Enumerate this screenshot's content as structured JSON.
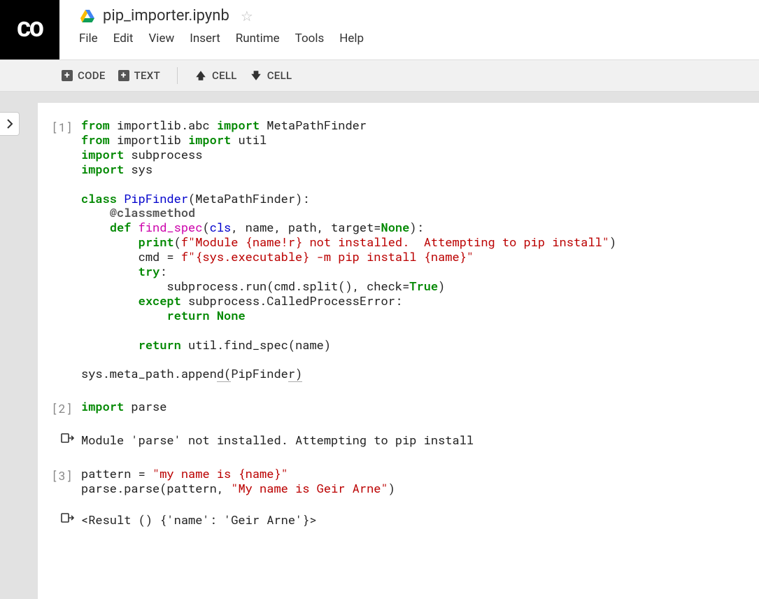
{
  "header": {
    "logo_text": "CO",
    "filename": "pip_importer.ipynb"
  },
  "menu": [
    "File",
    "Edit",
    "View",
    "Insert",
    "Runtime",
    "Tools",
    "Help"
  ],
  "toolbar": {
    "code": "CODE",
    "text": "TEXT",
    "cell_up": "CELL",
    "cell_down": "CELL"
  },
  "cells": [
    {
      "prompt": "[1]",
      "code_html": "<span class='kw'>from</span> importlib.abc <span class='kw'>import</span> MetaPathFinder\n<span class='kw'>from</span> importlib <span class='kw'>import</span> util\n<span class='kw'>import</span> subprocess\n<span class='kw'>import</span> sys\n\n<span class='kw'>class</span> <span class='nm'>PipFinder</span>(MetaPathFinder):\n    <span class='dec'>@classmethod</span>\n    <span class='kw'>def</span> <span class='fn'>find_spec</span>(<span class='nm'>cls</span>, name, path, target=<span class='kw'>None</span>):\n        <span class='kw'>print</span>(<span class='str'>f\"Module {name!r}</span><span class='str'> not installed.  Attempting to pip install\"</span>)\n        cmd = <span class='str'>f\"{sys.executable}</span><span class='str'> -m pip install </span><span class='str'>{name}</span><span class='str'>\"</span>\n        <span class='kw'>try</span>:\n            subprocess.run(cmd.split(), check=<span class='kw'>True</span>)\n        <span class='kw'>except</span> subprocess.CalledProcessError:\n            <span class='kw'>return</span> <span class='kw'>None</span>\n\n        <span class='kw'>return</span> util.find_spec(name)\n\nsys.meta_path.appen<span class='tok-u'>d(</span>PipFinde<span class='tok-u'>r)</span>",
      "output": null
    },
    {
      "prompt": "[2]",
      "code_html": "<span class='kw'>import</span> parse",
      "output": "Module 'parse' not installed.  Attempting to pip install"
    },
    {
      "prompt": "[3]",
      "code_html": "pattern = <span class='str'>\"my name is {name}\"</span>\nparse.parse(pattern, <span class='str'>\"My name is Geir Arne\"</span>)",
      "output": "<Result () {'name': 'Geir Arne'}>"
    }
  ]
}
